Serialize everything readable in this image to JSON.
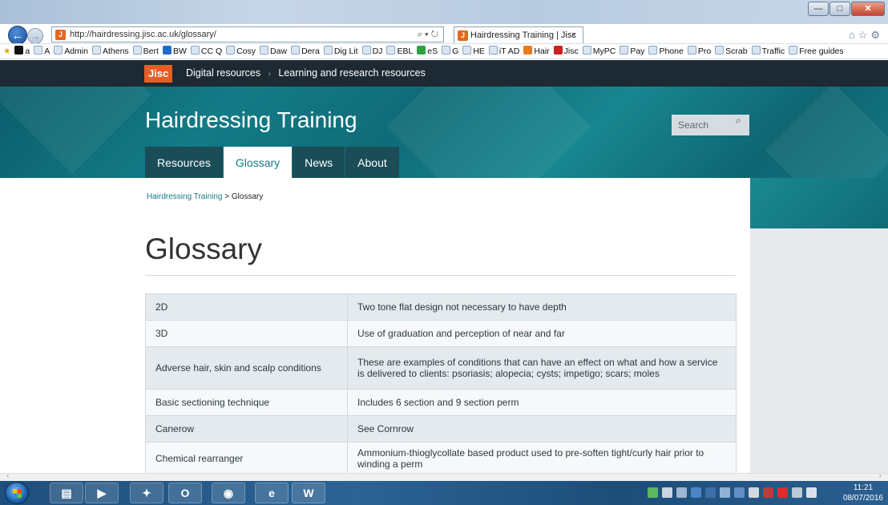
{
  "browser": {
    "url": "http://hairdressing.jisc.ac.uk/glossary/",
    "url_search_controls": "⌕ ▾ ↻",
    "tab_title": "Hairdressing Training | Jisc",
    "tab_close": "×",
    "win_min": "—",
    "win_max": "□",
    "win_close": "✕",
    "favorites": [
      {
        "label": "a",
        "icon": "amazon-icon",
        "color": "#111111"
      },
      {
        "label": "A",
        "icon": "page-icon"
      },
      {
        "label": "Admin",
        "icon": "page-icon"
      },
      {
        "label": "Athens",
        "icon": "page-icon"
      },
      {
        "label": "Bert",
        "icon": "page-icon"
      },
      {
        "label": "BW",
        "icon": "b-icon",
        "color": "#1c6dc9"
      },
      {
        "label": "CC Q",
        "icon": "page-icon"
      },
      {
        "label": "Cosy",
        "icon": "page-icon"
      },
      {
        "label": "Daw",
        "icon": "page-icon"
      },
      {
        "label": "Dera",
        "icon": "page-icon"
      },
      {
        "label": "Dig Lit",
        "icon": "page-icon"
      },
      {
        "label": "DJ",
        "icon": "page-icon"
      },
      {
        "label": "EBL",
        "icon": "page-icon"
      },
      {
        "label": "eS",
        "icon": "green-icon",
        "color": "#2ea243"
      },
      {
        "label": "G",
        "icon": "google-icon"
      },
      {
        "label": "HE",
        "icon": "page-icon"
      },
      {
        "label": "iT AD",
        "icon": "page-icon"
      },
      {
        "label": "Hair",
        "icon": "jisc-icon",
        "color": "#ea7a1f"
      },
      {
        "label": "Jisc",
        "icon": "red-icon",
        "color": "#c92222"
      },
      {
        "label": "MyPC",
        "icon": "page-icon"
      },
      {
        "label": "Pay",
        "icon": "page-icon"
      },
      {
        "label": "Phone",
        "icon": "page-icon"
      },
      {
        "label": "Pro",
        "icon": "page-icon"
      },
      {
        "label": "Scrab",
        "icon": "page-icon"
      },
      {
        "label": "Traffic",
        "icon": "page-icon"
      },
      {
        "label": "Free guides",
        "icon": "page-icon"
      }
    ]
  },
  "site": {
    "logo": "Jisc",
    "topnav": [
      "Digital resources",
      "Learning and research resources"
    ],
    "title": "Hairdressing Training",
    "search_placeholder": "Search",
    "tabs": [
      {
        "label": "Resources",
        "active": false
      },
      {
        "label": "Glossary",
        "active": true
      },
      {
        "label": "News",
        "active": false
      },
      {
        "label": "About",
        "active": false
      }
    ],
    "accent": "#137b86"
  },
  "breadcrumb": {
    "home": "Hairdressing Training",
    "separator": ">",
    "current": "Glossary"
  },
  "page": {
    "title": "Glossary"
  },
  "glossary": [
    {
      "term": "2D",
      "definition": "Two tone flat design not necessary to have depth"
    },
    {
      "term": "3D",
      "definition": "Use of graduation and perception of near and far"
    },
    {
      "term": "Adverse hair, skin and scalp conditions",
      "definition": "These are examples of conditions that can have an effect on what and how a service is delivered to clients: psoriasis; alopecia; cysts; impetigo; scars; moles"
    },
    {
      "term": "Basic sectioning technique",
      "definition": "Includes 6 section and 9 section perm"
    },
    {
      "term": "Canerow",
      "definition": "See Cornrow"
    },
    {
      "term": "Chemical rearranger",
      "definition": "Ammonium-thioglycollate based product used to pre-soften tight/curly hair prior to winding a perm"
    }
  ],
  "taskbar": {
    "time": "11:21",
    "date": "08/07/2016"
  }
}
